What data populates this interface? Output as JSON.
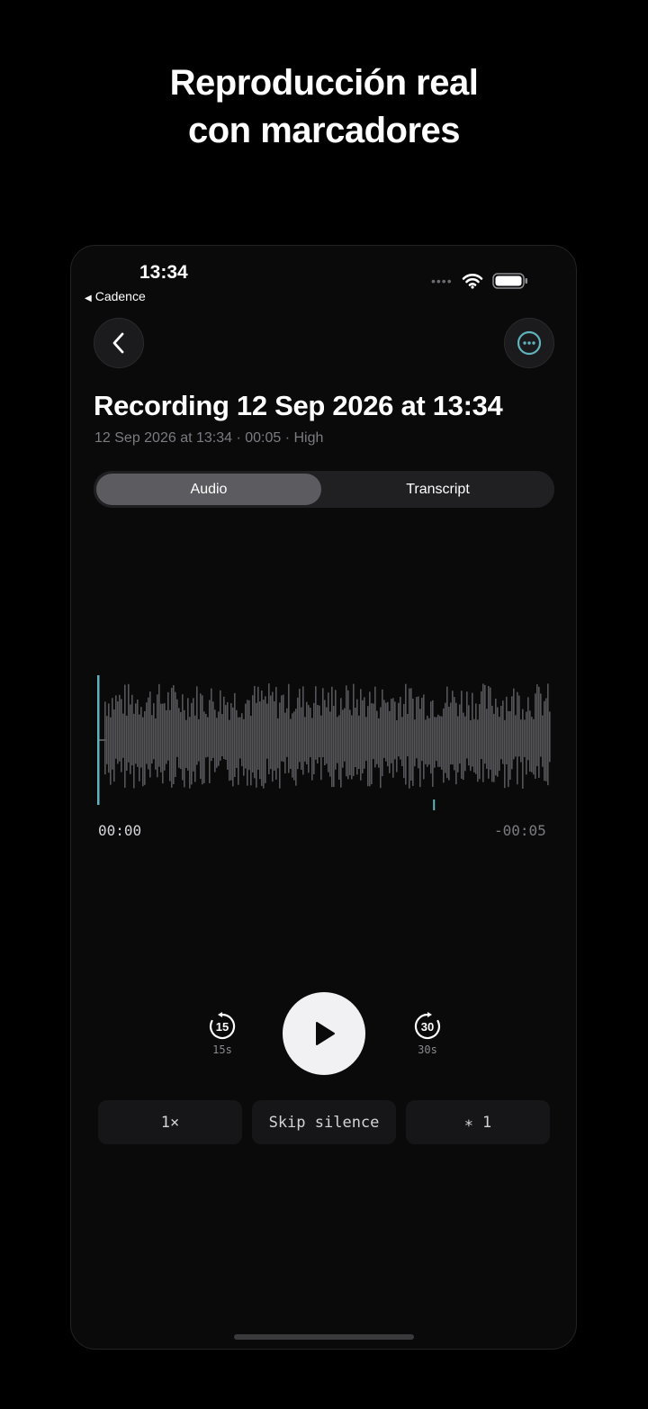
{
  "headline": {
    "line1": "Reproducción real",
    "line2": "con marcadores"
  },
  "status_bar": {
    "time": "13:34",
    "back_app": "Cadence"
  },
  "recording": {
    "title": "Recording 12 Sep 2026 at 13:34",
    "meta": "12 Sep 2026 at 13:34 · 00:05 · High"
  },
  "tabs": {
    "audio": "Audio",
    "transcript": "Transcript",
    "selected": "Audio"
  },
  "player": {
    "elapsed": "00:00",
    "remaining": "-00:05",
    "skip_back_label": "15s",
    "skip_back_number": "15",
    "skip_forward_label": "30s",
    "skip_forward_number": "30",
    "progress": 0.0,
    "marker_position": 0.74
  },
  "chips": {
    "speed": "1×",
    "skip_silence": "Skip silence",
    "bookmark_star": "*",
    "bookmark_count": "1"
  },
  "colors": {
    "accent": "#5fb3bd",
    "waveform": "#55555a",
    "play_button": "#f1f1f3"
  },
  "icons": {
    "back": "chevron-left-icon",
    "more": "ellipsis-circle-icon",
    "play": "play-icon",
    "skip_back": "rotate-ccw-15-icon",
    "skip_forward": "rotate-cw-30-icon",
    "wifi": "wifi-icon",
    "battery": "battery-icon"
  }
}
